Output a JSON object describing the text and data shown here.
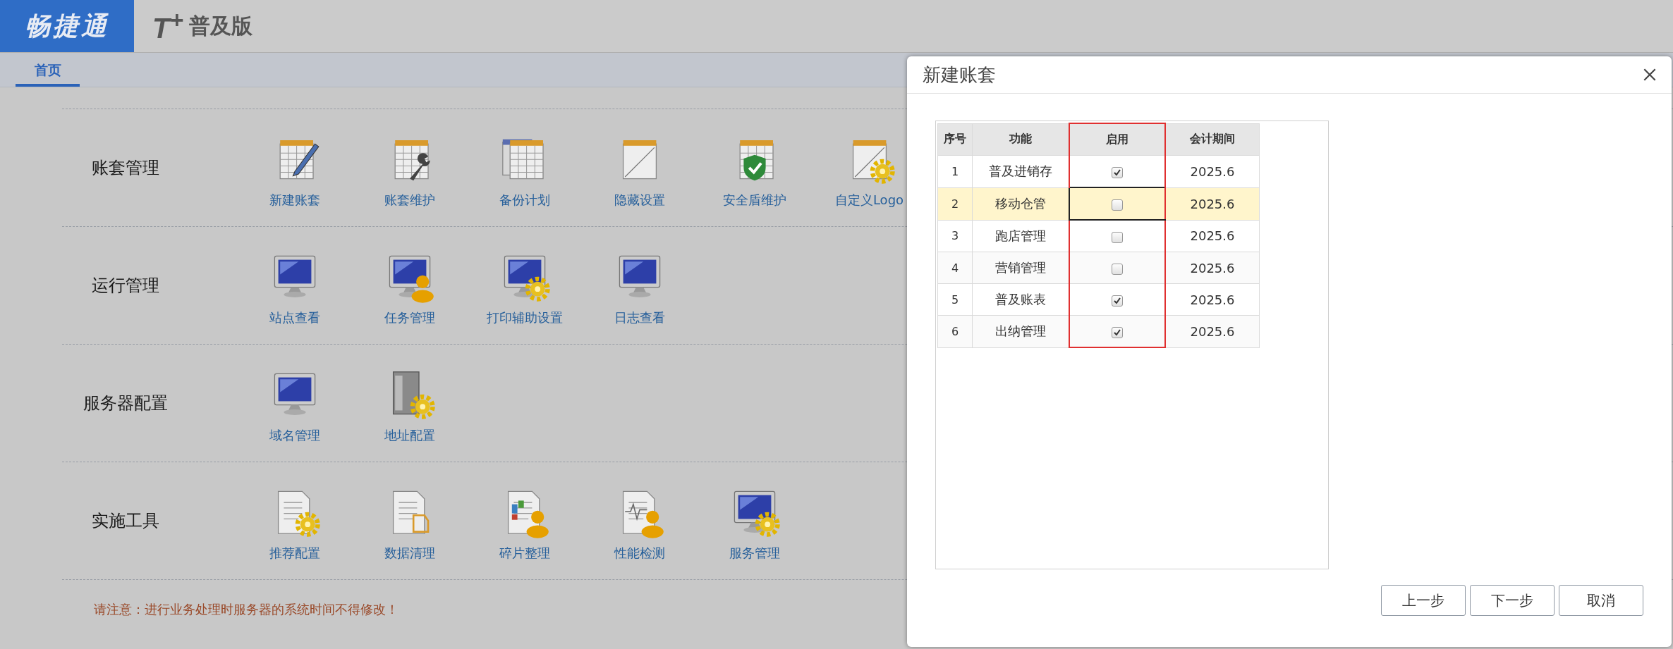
{
  "header": {
    "logo": "畅捷通",
    "brand": "T$^{+}$",
    "edition": "普及版"
  },
  "tabs": [
    {
      "label": "首页",
      "selected": true
    }
  ],
  "sections": [
    {
      "title": "账套管理",
      "items": [
        {
          "label": "新建账套",
          "kind": "calendar-pen"
        },
        {
          "label": "账套维护",
          "kind": "calendar-wrench"
        },
        {
          "label": "备份计划",
          "kind": "calendars"
        },
        {
          "label": "隐藏设置",
          "kind": "calendar"
        },
        {
          "label": "安全盾维护",
          "kind": "calendar-shield"
        },
        {
          "label": "自定义Logo",
          "kind": "page-gear"
        }
      ]
    },
    {
      "title": "运行管理",
      "items": [
        {
          "label": "站点查看",
          "kind": "monitor"
        },
        {
          "label": "任务管理",
          "kind": "monitor-person"
        },
        {
          "label": "打印辅助设置",
          "kind": "monitor-gear"
        },
        {
          "label": "日志查看",
          "kind": "monitor"
        }
      ]
    },
    {
      "title": "服务器配置",
      "items": [
        {
          "label": "域名管理",
          "kind": "monitor"
        },
        {
          "label": "地址配置",
          "kind": "server-gear"
        }
      ]
    },
    {
      "title": "实施工具",
      "items": [
        {
          "label": "推荐配置",
          "kind": "document-gear"
        },
        {
          "label": "数据清理",
          "kind": "document"
        },
        {
          "label": "碎片整理",
          "kind": "document-person"
        },
        {
          "label": "性能检测",
          "kind": "chart-person"
        },
        {
          "label": "服务管理",
          "kind": "monitor-gear"
        }
      ]
    }
  ],
  "note": "请注意：进行业务处理时服务器的系统时间不得修改！",
  "dialog": {
    "title": "新建账套",
    "columns": [
      {
        "label": "序号",
        "highlight": false
      },
      {
        "label": "功能",
        "highlight": false
      },
      {
        "label": "启用",
        "highlight": true
      },
      {
        "label": "会计期间",
        "highlight": false
      }
    ],
    "rows": [
      {
        "no": "1",
        "name": "普及进销存",
        "enabled": true,
        "period": "2025.6",
        "selected": false,
        "focused": false
      },
      {
        "no": "2",
        "name": "移动仓管",
        "enabled": false,
        "period": "2025.6",
        "selected": true,
        "focused": true
      },
      {
        "no": "3",
        "name": "跑店管理",
        "enabled": false,
        "period": "2025.6",
        "selected": false,
        "focused": false
      },
      {
        "no": "4",
        "name": "营销管理",
        "enabled": false,
        "period": "2025.6",
        "selected": false,
        "focused": false
      },
      {
        "no": "5",
        "name": "普及账表",
        "enabled": true,
        "period": "2025.6",
        "selected": false,
        "focused": false
      },
      {
        "no": "6",
        "name": "出纳管理",
        "enabled": true,
        "period": "2025.6",
        "selected": false,
        "focused": false
      }
    ],
    "buttons": [
      "上一步",
      "下一步",
      "取消"
    ]
  }
}
